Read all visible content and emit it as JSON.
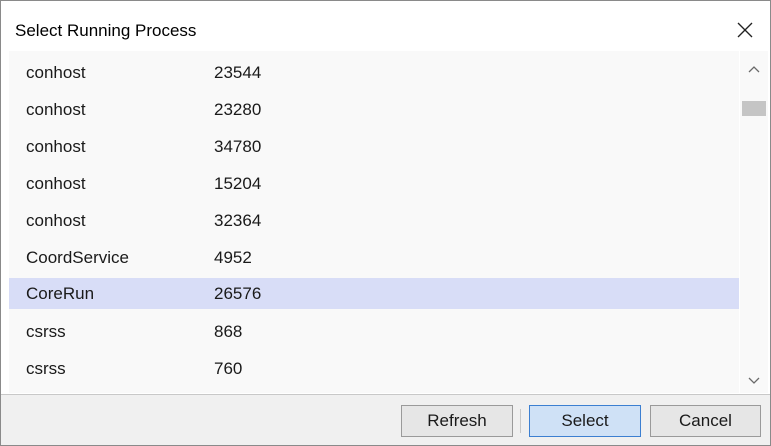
{
  "window": {
    "title": "Select Running Process"
  },
  "process_list": {
    "rows": [
      {
        "name": "conhost",
        "pid": "23544"
      },
      {
        "name": "conhost",
        "pid": "23280"
      },
      {
        "name": "conhost",
        "pid": "34780"
      },
      {
        "name": "conhost",
        "pid": "15204"
      },
      {
        "name": "conhost",
        "pid": "32364"
      },
      {
        "name": "CoordService",
        "pid": "4952"
      },
      {
        "name": "CoreRun",
        "pid": "26576"
      },
      {
        "name": "csrss",
        "pid": "868"
      },
      {
        "name": "csrss",
        "pid": "760"
      }
    ],
    "selected_name": "CoreRun",
    "selection_color": "#d8ddf7"
  },
  "footer": {
    "refresh_label": "Refresh",
    "select_label": "Select",
    "cancel_label": "Cancel"
  },
  "icons": {
    "close": "close-icon",
    "scroll_up": "chevron-up-icon",
    "scroll_down": "chevron-down-icon"
  }
}
